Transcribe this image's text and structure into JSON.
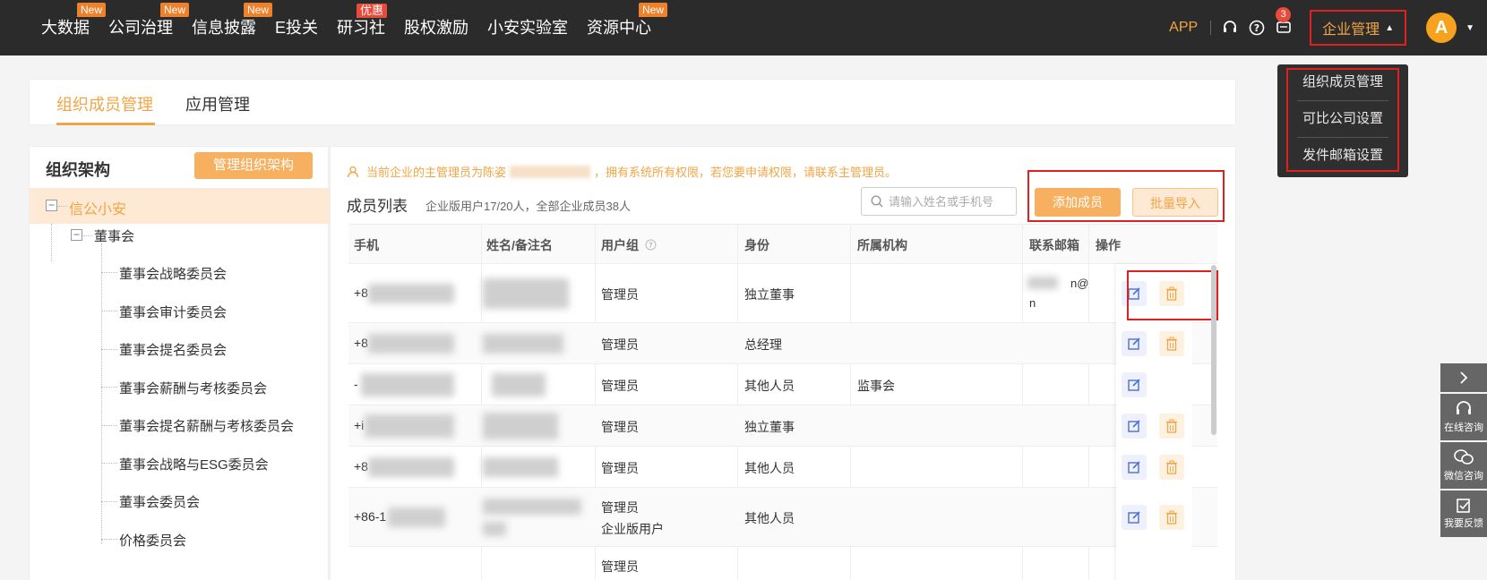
{
  "nav": {
    "items": [
      {
        "label": "大数据",
        "badge": "New"
      },
      {
        "label": "公司治理",
        "badge": "New"
      },
      {
        "label": "信息披露",
        "badge": "New"
      },
      {
        "label": "E投关",
        "badge": ""
      },
      {
        "label": "研习社",
        "badge": "优惠"
      },
      {
        "label": "股权激励",
        "badge": ""
      },
      {
        "label": "小安实验室",
        "badge": ""
      },
      {
        "label": "资源中心",
        "badge": "New"
      }
    ],
    "app_label": "APP",
    "message_count": "3",
    "enterprise_mgmt": "企业管理",
    "avatar_letter": "A"
  },
  "dropdown": {
    "items": [
      "组织成员管理",
      "可比公司设置",
      "发件邮箱设置"
    ]
  },
  "tabs": [
    "组织成员管理",
    "应用管理"
  ],
  "org": {
    "title": "组织架构",
    "manage_button": "管理组织架构",
    "root": "信公小安",
    "level1": "董事会",
    "children": [
      "董事会战略委员会",
      "董事会审计委员会",
      "董事会提名委员会",
      "董事会薪酬与考核委员会",
      "董事会提名薪酬与考核委员会",
      "董事会战略与ESG委员会",
      "董事会委员会",
      "价格委员会"
    ]
  },
  "main": {
    "notice_prefix": "当前企业的主管理员为陈姿",
    "notice_suffix": "，拥有系统所有权限，若您要申请权限，请联系主管理员。",
    "list_title": "成员列表",
    "list_sub": "企业版用户17/20人，全部企业成员38人",
    "search_placeholder": "请输入姓名或手机号",
    "add_button": "添加成员",
    "import_button": "批量导入",
    "columns": [
      "手机",
      "姓名/备注名",
      "用户组",
      "身份",
      "所属机构",
      "联系邮箱",
      "操作"
    ],
    "rows": [
      {
        "phone": "+8",
        "group": "管理员",
        "group2": "",
        "role": "独立董事",
        "org": "",
        "email_a": "n@",
        "email_b": "n",
        "can_delete": true
      },
      {
        "phone": "+8",
        "group": "管理员",
        "group2": "",
        "role": "总经理",
        "org": "",
        "email_a": "",
        "email_b": "",
        "can_delete": true
      },
      {
        "phone": "-",
        "group": "管理员",
        "group2": "",
        "role": "其他人员",
        "org": "监事会",
        "email_a": "",
        "email_b": "",
        "can_delete": false
      },
      {
        "phone": "+i",
        "group": "管理员",
        "group2": "",
        "role": "独立董事",
        "org": "",
        "email_a": "",
        "email_b": "",
        "can_delete": true
      },
      {
        "phone": "+8",
        "group": "管理员",
        "group2": "",
        "role": "其他人员",
        "org": "",
        "email_a": "",
        "email_b": "",
        "can_delete": true
      },
      {
        "phone": "+86-1",
        "group": "管理员",
        "group2": "企业版用户",
        "role": "其他人员",
        "org": "",
        "email_a": "",
        "email_b": "",
        "can_delete": true
      },
      {
        "phone": "",
        "group": "管理员",
        "group2": "",
        "role": "",
        "org": "",
        "email_a": "",
        "email_b": "",
        "can_delete": false
      }
    ]
  },
  "side_float": [
    "在线咨询",
    "微信咨询",
    "我要反馈"
  ],
  "colors": {
    "accent": "#f2a545",
    "highlight_frame": "#e02020",
    "topbar": "#2b2b2b"
  }
}
